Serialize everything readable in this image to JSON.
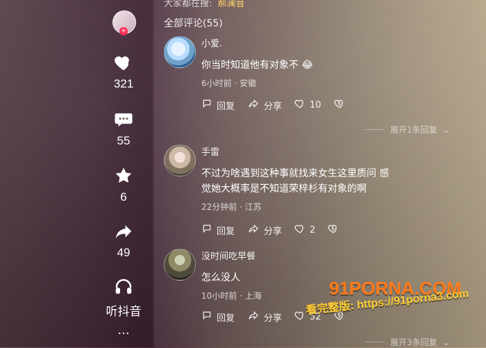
{
  "search_bar": {
    "prefix": "大家都在搜:",
    "keyword": "郝澜音"
  },
  "comments_header": {
    "title": "全部评论(55)"
  },
  "side_actions": {
    "likes": "321",
    "comments": "55",
    "favorites": "6",
    "shares": "49",
    "listen_label": "听抖音"
  },
  "comments": [
    {
      "username": "小爱.",
      "text": "你当时知道他有对象不 😂",
      "meta": "6小时前 · 安徽",
      "reply_label": "回复",
      "share_label": "分享",
      "likes": "10",
      "expand_label": "展开1条回复"
    },
    {
      "username": "手雷",
      "text": "不过为啥遇到这种事就找来女生这里质问 感\n觉她大概率是不知道荣梓杉有对象的啊",
      "meta": "22分钟前 · 江苏",
      "reply_label": "回复",
      "share_label": "分享",
      "likes": "2"
    },
    {
      "username": "没时间吃早餐",
      "text": "怎么没人",
      "meta": "10小时前 · 上海",
      "reply_label": "回复",
      "share_label": "分享",
      "likes": "52",
      "expand_label": "展开3条回复"
    }
  ],
  "watermark": {
    "logo": "91PORNA.COM",
    "link_prefix": "看完整版:",
    "link_url": "https://91porna3.com"
  }
}
